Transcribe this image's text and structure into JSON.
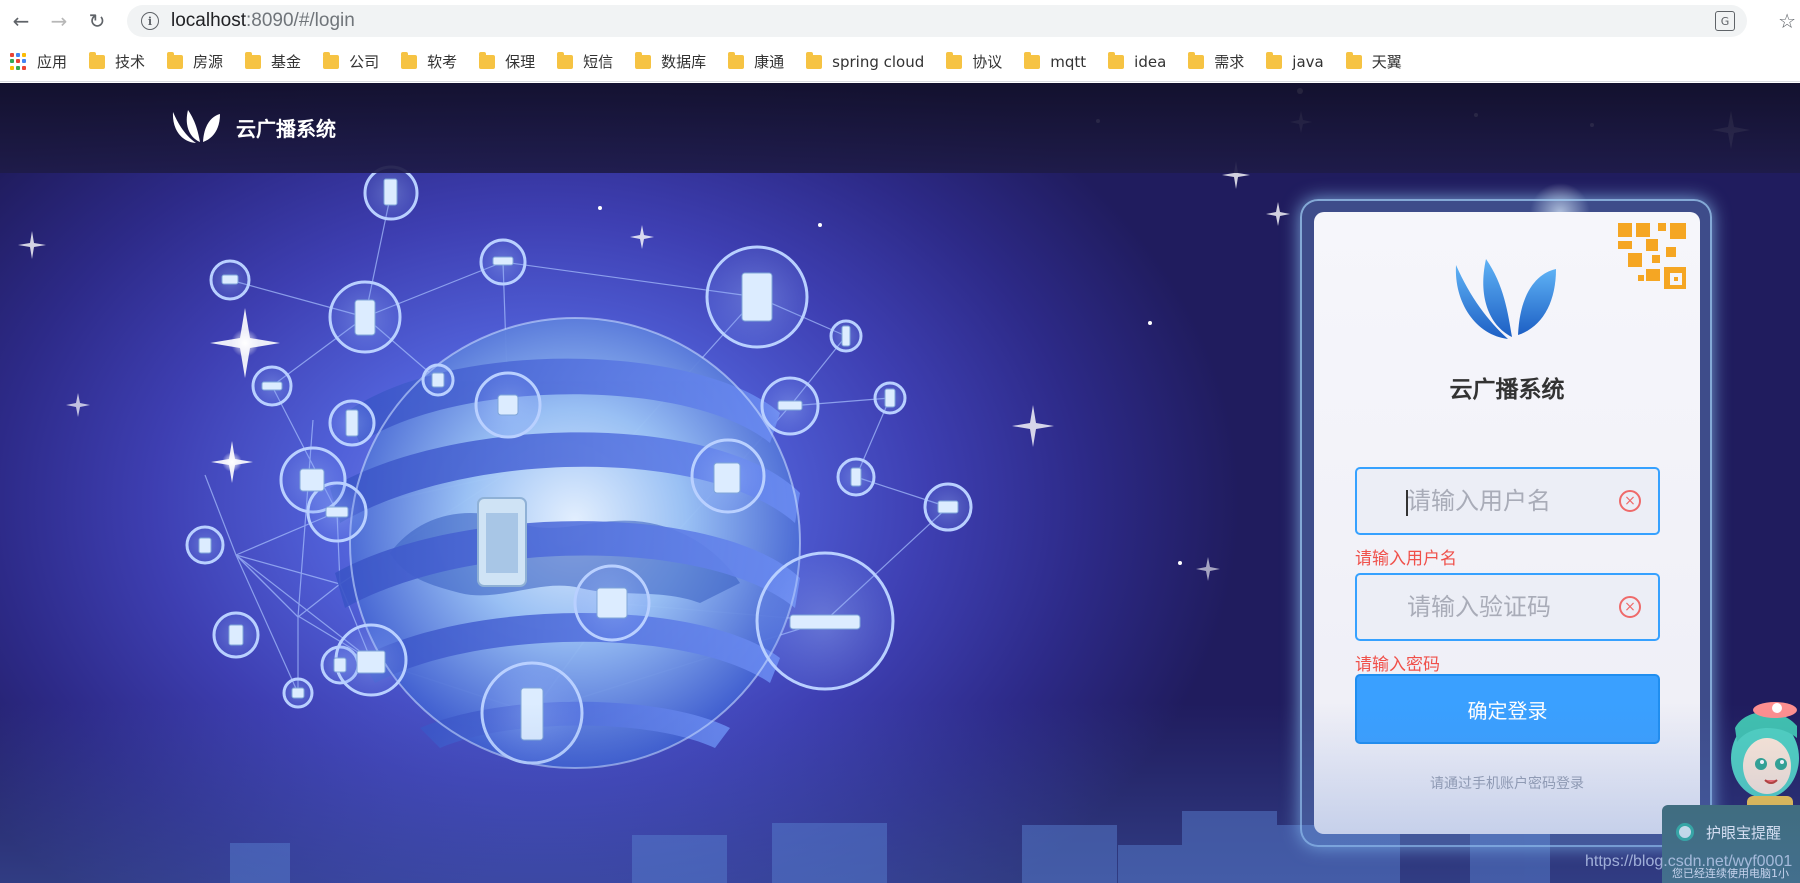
{
  "browser": {
    "url_host": "localhost",
    "url_path": ":8090/#/login",
    "bookmarks": [
      "应用",
      "技术",
      "房源",
      "基金",
      "公司",
      "软考",
      "保理",
      "短信",
      "数据库",
      "康通",
      "spring cloud",
      "协议",
      "mqtt",
      "idea",
      "需求",
      "java",
      "天翼"
    ]
  },
  "header": {
    "brand_name": "云广播系统"
  },
  "login": {
    "title": "云广播系统",
    "username_placeholder": "请输入用户名",
    "username_error": "请输入用户名",
    "password_placeholder": "请输入验证码",
    "password_error": "请输入密码",
    "submit_label": "确定登录",
    "hint": "请通过手机账户密码登录"
  },
  "widget": {
    "label": "护眼宝提醒",
    "sub": "您已经连续使用电脑1小",
    "watermark": "https://blog.csdn.net/wyf0001"
  },
  "colors": {
    "accent": "#3aa0ff",
    "error": "#f0504a",
    "brand_blue": "#2f7fd8",
    "qr_orange": "#f5a623"
  }
}
